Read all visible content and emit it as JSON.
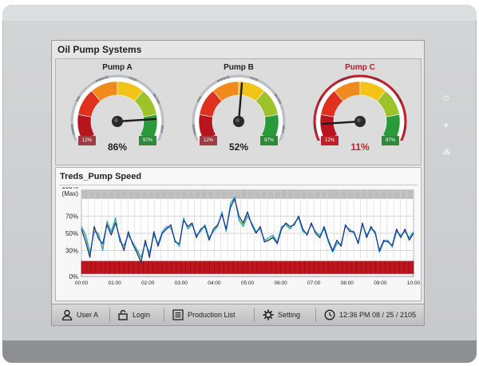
{
  "app": {
    "title": "Oil Pump Systems"
  },
  "gauges": [
    {
      "name": "Pump A",
      "value_label": "86%",
      "value": 86,
      "min_label": "12%",
      "max_label": "97%",
      "alert": false
    },
    {
      "name": "Pump B",
      "value_label": "52%",
      "value": 52,
      "min_label": "12%",
      "max_label": "97%",
      "alert": false
    },
    {
      "name": "Pump C",
      "value_label": "11%",
      "value": 11,
      "min_label": "12%",
      "max_label": "97%",
      "alert": true
    }
  ],
  "gauge_scale_labels": [
    "WORSE",
    "BAD",
    "AVERAGE",
    "GOOD",
    "BETTER",
    "BEST"
  ],
  "chart_data": {
    "type": "line",
    "title": "Treds_Pump Speed",
    "x_ticks": [
      "00:00",
      "01:00",
      "02:00",
      "03:00",
      "04:00",
      "05:00",
      "06:00",
      "07:00",
      "08:00",
      "09:00",
      "10:00"
    ],
    "y_ticks": [
      "0%",
      "30%",
      "50%",
      "70%",
      "100%\n(Max)"
    ],
    "ylim": [
      0,
      100
    ],
    "xlim": [
      0,
      10
    ],
    "series": [
      {
        "color": "#1a2f8f",
        "values": [
          55,
          40,
          22,
          58,
          44,
          38,
          60,
          48,
          62,
          45,
          30,
          52,
          38,
          28,
          16,
          42,
          22,
          52,
          35,
          50,
          55,
          60,
          40,
          38,
          65,
          58,
          62,
          45,
          55,
          58,
          42,
          55,
          60,
          72,
          55,
          80,
          90,
          70,
          62,
          75,
          60,
          50,
          58,
          40,
          42,
          45,
          38,
          55,
          62,
          58,
          60,
          70,
          55,
          48,
          62,
          50,
          45,
          58,
          42,
          30,
          42,
          35,
          60,
          52,
          52,
          38,
          62,
          45,
          58,
          50,
          30,
          42,
          40,
          36,
          55,
          45,
          55,
          42,
          50
        ]
      },
      {
        "color": "#1aa6e0",
        "values": [
          58,
          48,
          28,
          52,
          50,
          30,
          64,
          52,
          68,
          40,
          36,
          48,
          40,
          32,
          22,
          38,
          28,
          48,
          38,
          52,
          58,
          56,
          42,
          35,
          68,
          55,
          60,
          48,
          52,
          60,
          45,
          52,
          58,
          75,
          52,
          85,
          92,
          65,
          58,
          70,
          62,
          52,
          55,
          42,
          45,
          48,
          40,
          58,
          60,
          55,
          62,
          68,
          52,
          50,
          60,
          52,
          48,
          55,
          40,
          28,
          38,
          38,
          58,
          55,
          50,
          40,
          60,
          48,
          55,
          52,
          28,
          40,
          42,
          34,
          52,
          48,
          52,
          45,
          52
        ]
      },
      {
        "color": "#b8c93a",
        "values": [
          56,
          45,
          25,
          55,
          47,
          34,
          62,
          50,
          65,
          42,
          33,
          50,
          39,
          30,
          19,
          40,
          25,
          50,
          36,
          51,
          56,
          58,
          41,
          36,
          66,
          56,
          61,
          46,
          53,
          59,
          43,
          53,
          59,
          73,
          53,
          82,
          91,
          67,
          60,
          72,
          61,
          51,
          56,
          41,
          43,
          46,
          39,
          56,
          61,
          56,
          61,
          69,
          53,
          49,
          61,
          51,
          46,
          56,
          41,
          29,
          40,
          36,
          59,
          53,
          51,
          39,
          61,
          46,
          56,
          51,
          29,
          41,
          41,
          35,
          53,
          46,
          53,
          43,
          51
        ]
      }
    ]
  },
  "toolbar": {
    "user_label": "User A",
    "login_label": "Login",
    "production_label": "Production List",
    "setting_label": "Setting",
    "datetime_label": "12:36 PM  08 / 25 / 2105"
  }
}
